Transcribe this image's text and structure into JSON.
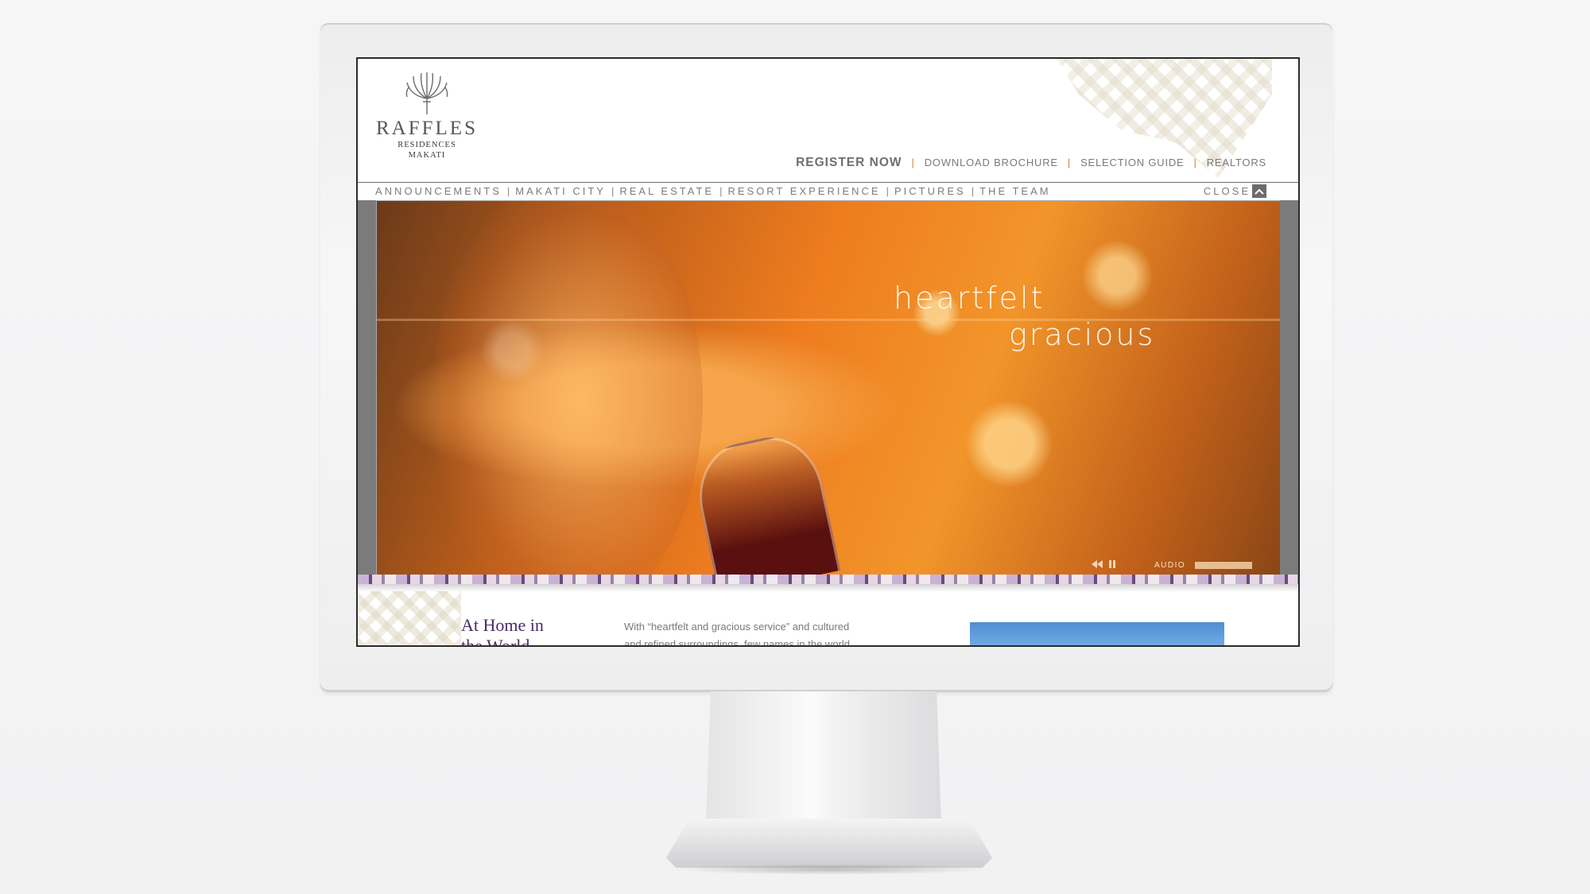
{
  "logo": {
    "name": "RAFFLES",
    "line1": "RESIDENCES",
    "line2": "MAKATI",
    "icon": "traveller-palm-tree-icon"
  },
  "top_nav": {
    "register": "REGISTER NOW",
    "brochure": "DOWNLOAD BROCHURE",
    "guide": "SELECTION GUIDE",
    "realtors": "REALTORS",
    "separator": "|"
  },
  "sec_nav": {
    "items": [
      "ANNOUNCEMENTS",
      "MAKATI CITY",
      "REAL ESTATE",
      "RESORT EXPERIENCE",
      "PICTURES",
      "THE TEAM"
    ],
    "separator": "|",
    "close_label": "CLOSE",
    "close_icon": "chevron-up-icon"
  },
  "hero": {
    "headline_1": "heartfelt",
    "headline_2": "gracious",
    "audio_label": "AUDIO",
    "audio_level": 1.0,
    "rewind_icon": "rewind-icon",
    "pause_icon": "pause-icon"
  },
  "content": {
    "heading_1": "At Home in",
    "heading_2": "the World",
    "body_1": "With “heartfelt and gracious service” and cultured",
    "body_2": "and refined surroundings, few names in the world"
  },
  "colors": {
    "accent_separator": "#c98a3a",
    "heading_purple": "#4b2a64",
    "hero_orange": "#ee7c1f"
  }
}
